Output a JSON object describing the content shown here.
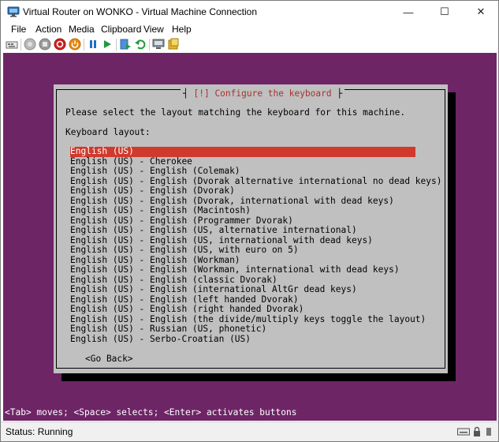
{
  "window": {
    "title": "Virtual Router on WONKO - Virtual Machine Connection",
    "controls": {
      "minimize": "—",
      "maximize": "☐",
      "close": "✕"
    }
  },
  "menu": [
    {
      "label": "File"
    },
    {
      "label": "Action"
    },
    {
      "label": "Media"
    },
    {
      "label": "Clipboard"
    },
    {
      "label": "View"
    },
    {
      "label": "Help"
    }
  ],
  "toolbar": {
    "icons": [
      "ctrl-alt-del-icon",
      "start-icon",
      "turn-off-icon",
      "shut-down-icon",
      "power-icon",
      "pause-icon",
      "resume-icon",
      "checkpoint-icon",
      "revert-icon",
      "enhanced-session-icon",
      "share-icon"
    ]
  },
  "installer": {
    "dialog_title_bracket_left": "┤",
    "dialog_title": "[!] Configure the keyboard",
    "dialog_title_bracket_right": "├",
    "prompt": "Please select the layout matching the keyboard for this machine.",
    "layout_label": "Keyboard layout:",
    "layouts": [
      "English (US)",
      "English (US) - Cherokee",
      "English (US) - English (Colemak)",
      "English (US) - English (Dvorak alternative international no dead keys)",
      "English (US) - English (Dvorak)",
      "English (US) - English (Dvorak, international with dead keys)",
      "English (US) - English (Macintosh)",
      "English (US) - English (Programmer Dvorak)",
      "English (US) - English (US, alternative international)",
      "English (US) - English (US, international with dead keys)",
      "English (US) - English (US, with euro on 5)",
      "English (US) - English (Workman)",
      "English (US) - English (Workman, international with dead keys)",
      "English (US) - English (classic Dvorak)",
      "English (US) - English (international AltGr dead keys)",
      "English (US) - English (left handed Dvorak)",
      "English (US) - English (right handed Dvorak)",
      "English (US) - English (the divide/multiply keys toggle the layout)",
      "English (US) - Russian (US, phonetic)",
      "English (US) - Serbo-Croatian (US)"
    ],
    "selected_index": 0,
    "go_back": "<Go Back>",
    "hint": "<Tab> moves; <Space> selects; <Enter> activates buttons",
    "colors": {
      "background": "#6e2566",
      "dialog": "#c0c0c0",
      "selection": "#d03a2c",
      "title_text": "#a83232"
    }
  },
  "status": {
    "text": "Status: Running"
  }
}
